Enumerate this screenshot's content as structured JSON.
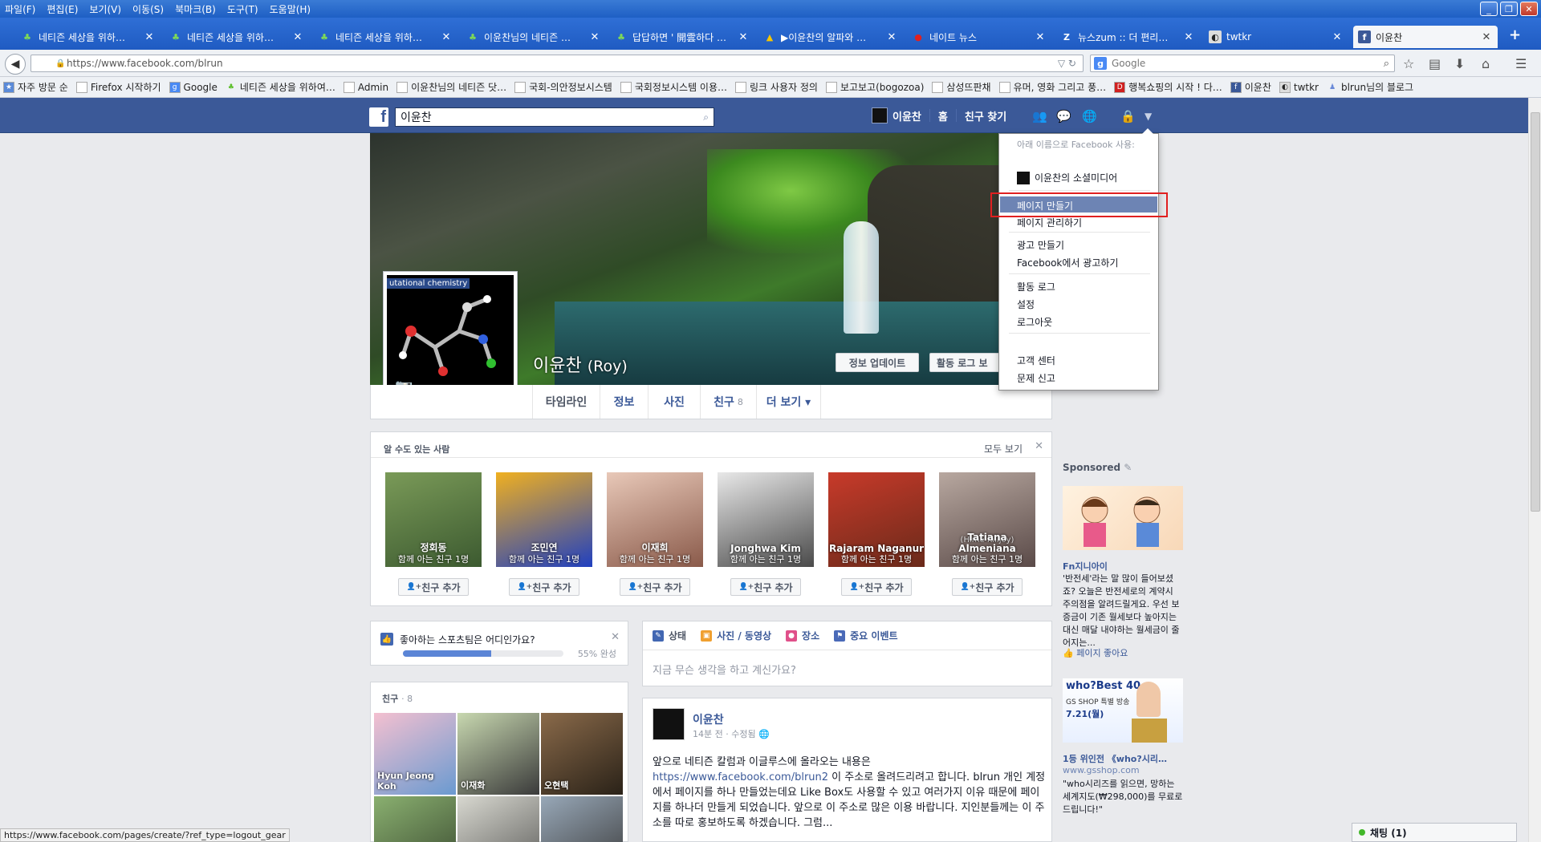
{
  "browser": {
    "menu": [
      "파일(F)",
      "편집(E)",
      "보기(V)",
      "이동(S)",
      "북마크(B)",
      "도구(T)",
      "도움말(H)"
    ],
    "tabs": [
      {
        "label": "네티즌 세상을 위하…",
        "icon": "sprout-icon"
      },
      {
        "label": "네티즌 세상을 위하…",
        "icon": "sprout-icon"
      },
      {
        "label": "네티즌 세상을 위하…",
        "icon": "sprout-icon"
      },
      {
        "label": "이윤찬님의 네티즌 …",
        "icon": "sprout-icon"
      },
      {
        "label": "답답하면 ' 開雲하다 …",
        "icon": "sprout-icon"
      },
      {
        "label": "▶이윤찬의 알파와 …",
        "icon": "drive-icon"
      },
      {
        "label": "네이트 뉴스",
        "icon": "nate-icon"
      },
      {
        "label": "뉴스zum :: 더 편리…",
        "icon": "zum-icon"
      },
      {
        "label": "twtkr",
        "icon": "twtkr-icon"
      },
      {
        "label": "이윤찬",
        "icon": "facebook-icon",
        "active": true
      }
    ],
    "url": "https://www.facebook.com/blrun",
    "search_placeholder": "Google",
    "bookmarks": [
      "자주 방문 순",
      "Firefox 시작하기",
      "Google",
      "네티즌 세상을 위하여…",
      "Admin",
      "이윤찬님의 네티즌 닷…",
      "국회-의안정보시스템",
      "국회정보시스템 이용…",
      "링크 사용자 정의",
      "보고보고(bogozoa)",
      "삼성뜨판채",
      "유머, 영화 그리고 풍…",
      "행복쇼핑의 시작 ! 다…",
      "이윤찬",
      "twtkr",
      "blrun님의 블로그"
    ],
    "status_url": "https://www.facebook.com/pages/create/?ref_type=logout_gear"
  },
  "fb": {
    "search_value": "이윤찬",
    "nav_name": "이윤찬",
    "nav_home": "홈",
    "nav_find": "친구 찾기",
    "profile_name": "이윤찬",
    "profile_alt": "(Roy)",
    "profile_pic_caption": "utational chemistry",
    "btn_update": "정보 업데이트",
    "btn_activity": "활동 로그 보",
    "tabs": [
      {
        "label": "타임라인"
      },
      {
        "label": "정보"
      },
      {
        "label": "사진"
      },
      {
        "label": "친구",
        "count": "8"
      },
      {
        "label": "더 보기 ▾"
      }
    ],
    "pymk_title": "알 수도 있는 사람",
    "pymk_see_all": "모두 보기",
    "pymk": [
      {
        "name": "정회동",
        "mutual": "함께 아는 친구 1명",
        "colors": [
          "#7a9a58",
          "#3c5a30"
        ]
      },
      {
        "name": "조민연",
        "mutual": "함께 아는 친구 1명",
        "colors": [
          "#f0b020",
          "#2040c0"
        ]
      },
      {
        "name": "이재희",
        "mutual": "함께 아는 친구 1명",
        "colors": [
          "#e8c8b8",
          "#8a5a4a"
        ]
      },
      {
        "name": "Jonghwa Kim",
        "mutual": "함께 아는 친구 1명",
        "colors": [
          "#e8e8e8",
          "#4a4a4a"
        ]
      },
      {
        "name": "Rajaram Naganur",
        "mutual": "함께 아는 친구 1명",
        "colors": [
          "#c83a2a",
          "#6a2a1a"
        ]
      },
      {
        "name": "Tatiana Almeniana",
        "alt": "(Hime Killjoy)",
        "mutual": "함께 아는 친구 1명",
        "colors": [
          "#b8a8a0",
          "#5a4a48"
        ]
      }
    ],
    "add_friend": "친구 추가",
    "sport_question": "좋아하는 스포츠팀은 어디인가요?",
    "sport_progress_pct": 55,
    "sport_progress": "55% 완성",
    "friends_title": "친구",
    "friends_count": "· 8",
    "friends": [
      {
        "name": "Hyun Jeong Koh",
        "colors": [
          "#f4c0d0",
          "#6a9ad0"
        ]
      },
      {
        "name": "이재화",
        "colors": [
          "#c8d8b0",
          "#3a3a3a"
        ]
      },
      {
        "name": "오현택",
        "colors": [
          "#8a6a4a",
          "#2a2218"
        ]
      },
      {
        "name": "",
        "colors": [
          "#8ab070",
          "#3a4a30"
        ]
      },
      {
        "name": "",
        "colors": [
          "#d8d8d0",
          "#5a5a58"
        ]
      },
      {
        "name": "",
        "colors": [
          "#98a8b8",
          "#3a3a3a"
        ]
      }
    ],
    "composer_tabs": [
      "상태",
      "사진 / 동영상",
      "장소",
      "중요 이벤트"
    ],
    "composer_placeholder": "지금 무슨 생각을 하고 계신가요?",
    "post": {
      "author": "이윤찬",
      "meta": "14분 전 · 수정됨",
      "text1": "앞으로 네티즌 칼럼과 이글루스에 올라오는 내용은 ",
      "link": "https://www.facebook.com/blrun2",
      "text2": " 이 주소로 올려드리려고 합니다. blrun 개인 계정에서 페이지를 하나 만들었는데요 Like Box도 사용할 수 있고 여러가지 이유 때문에 페이지를 하나더 만들게 되었습니다. 앞으로 이 주소로 많은 이용 바랍니다. 지인분들께는 이 주소를 따로 홍보하도록 하겠습니다. 그럼..."
    },
    "ads": {
      "sponsored": "Sponsored",
      "ad1_title": "Fn지니아이",
      "ad1_text": "'반전세'라는 말 많이 들어보셨죠? 오늘은 반전세로의 계약시 주의점을 알려드릴게요. 우선 보증금이 기존 월세보다 높아지는 대신 매달 내야하는 월세금이 줄어지는...",
      "ad1_like": "페이지 좋아요",
      "ad2_img_text": "who?Best 40",
      "ad2_img_sub": "GS SHOP 특별 방송",
      "ad2_img_date": "7.21(월)",
      "ad2_title": "1등 위인전 《who?시리…",
      "ad2_url": "www.gsshop.com",
      "ad2_text": "\"who시리즈를 읽으면, 망하는 세계지도(₩298,000)를 무료로 드립니다!\""
    },
    "dropdown": {
      "head": "아래 이름으로 Facebook 사용:",
      "page_name": "이윤찬의 소셜미디어",
      "create_page": "페이지 만들기",
      "manage_pages": "페이지 관리하기",
      "create_ad": "광고 만들기",
      "advertise": "Facebook에서 광고하기",
      "activity_log": "활동 로그",
      "settings": "설정",
      "logout": "로그아웃",
      "help": "고객 센터",
      "report": "문제 신고"
    },
    "chat": "채팅 (1)"
  }
}
